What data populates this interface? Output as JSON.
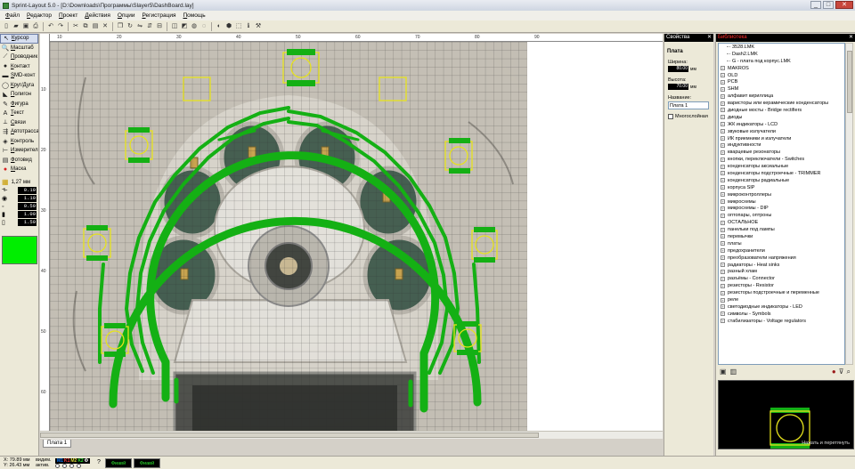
{
  "window": {
    "title": "Sprint-Layout 5.0 - [D:\\Downloads\\Программы\\Slayer5\\DashBoard.lay]",
    "controls": [
      "_",
      "□",
      "✕"
    ]
  },
  "menu": [
    "Файл",
    "Редактор",
    "Проект",
    "Действия",
    "Опции",
    "Регистрация",
    "Помощь"
  ],
  "toolbar": {
    "icons": [
      "new-icon",
      "open-icon",
      "save-icon",
      "print-icon",
      "undo-icon",
      "redo-icon",
      "cut-icon",
      "copy-icon",
      "paste-icon",
      "delete-icon",
      "duplicate-icon",
      "rotate-icon",
      "mirror-h-icon",
      "mirror-v-icon",
      "align-icon",
      "group-icon",
      "ungroup-icon",
      "lock-icon",
      "unlock-icon",
      "zoom-icon",
      "autoroute-icon",
      "drc-icon",
      "info-icon",
      "tool-icon"
    ],
    "glyphs": [
      "▯",
      "▰",
      "▣",
      "⎙",
      "↶",
      "↷",
      "✂",
      "⧉",
      "▤",
      "✕",
      "❐",
      "↻",
      "⇋",
      "⇵",
      "⊟",
      "◫",
      "◩",
      "◍",
      "◌",
      "◐",
      "⬢",
      "⬚",
      "ℹ",
      "⚒"
    ]
  },
  "tools": [
    {
      "label": "Курсор",
      "icon": "cursor-icon",
      "glyph": "↖",
      "active": true
    },
    {
      "label": "Масштаб",
      "icon": "zoom-icon",
      "glyph": "🔍",
      "active": false
    },
    {
      "label": "Проводник",
      "icon": "track-icon",
      "glyph": "⟋",
      "active": false
    },
    {
      "label": "Контакт",
      "icon": "pad-icon",
      "glyph": "●",
      "active": false
    },
    {
      "label": "SMD-конт",
      "icon": "smd-pad-icon",
      "glyph": "▬",
      "active": false
    },
    {
      "label": "Круг/Дуга",
      "icon": "circle-arc-icon",
      "glyph": "◯",
      "active": false
    },
    {
      "label": "Полигон",
      "icon": "polygon-icon",
      "glyph": "◣",
      "active": false
    },
    {
      "label": "Фигура",
      "icon": "shape-icon",
      "glyph": "✎",
      "active": false
    },
    {
      "label": "Текст",
      "icon": "text-icon",
      "glyph": "A",
      "active": false
    },
    {
      "label": "Связи",
      "icon": "connections-icon",
      "glyph": "⟂",
      "active": false
    },
    {
      "label": "Автотрасса",
      "icon": "autoroute-icon",
      "glyph": "⇶",
      "active": false
    },
    {
      "label": "Контроль",
      "icon": "test-icon",
      "glyph": "◈",
      "active": false
    },
    {
      "label": "Измеритель",
      "icon": "measure-icon",
      "glyph": "⊢",
      "active": false
    },
    {
      "label": "Фотовид",
      "icon": "photoview-icon",
      "glyph": "▤",
      "active": false
    },
    {
      "label": "Маска",
      "icon": "mask-icon",
      "glyph": "●",
      "active": false
    }
  ],
  "grid": {
    "value": "1,27 мм"
  },
  "params": [
    {
      "name": "track-width",
      "icon": "track-width-icon",
      "glyph": "⟛",
      "value": "0.10"
    },
    {
      "name": "pad-outer",
      "icon": "pad-size-icon",
      "glyph": "◉",
      "value": "1.10"
    },
    {
      "name": "pad-inner",
      "icon": "pad-hole-icon",
      "glyph": "◦",
      "value": "0.50"
    },
    {
      "name": "smd-width",
      "icon": "smd-width-icon",
      "glyph": "▮",
      "value": "1.00"
    },
    {
      "name": "smd-height",
      "icon": "smd-height-icon",
      "glyph": "▯",
      "value": "1.50"
    }
  ],
  "current_color": "#00ee00",
  "ruler": {
    "top_labels": [
      "10",
      "20",
      "30",
      "40",
      "50",
      "60",
      "70",
      "80",
      "90"
    ],
    "left_labels": [
      "10",
      "20",
      "30",
      "40",
      "50",
      "60"
    ]
  },
  "board_tab": "Плата 1",
  "properties": {
    "header": "Свойства",
    "section": "Плата",
    "width_label": "Ширина:",
    "width_value": "80.00",
    "height_label": "Высота:",
    "height_value": "70.00",
    "unit": "мм",
    "name_label": "Название:",
    "name_value": "Плата 1",
    "multilayer_label": "Многослойная"
  },
  "library": {
    "header": "Библиотека",
    "items": [
      {
        "label": "3528.LMK",
        "leaf": true
      },
      {
        "label": "Dash2.LMK",
        "leaf": true
      },
      {
        "label": "G - плата под корпус.LMK",
        "leaf": true
      },
      {
        "label": "MAKROS",
        "leaf": false
      },
      {
        "label": "OLD",
        "leaf": false
      },
      {
        "label": "PCB",
        "leaf": false
      },
      {
        "label": "SHM",
        "leaf": false
      },
      {
        "label": "алфавит кириллица",
        "leaf": false
      },
      {
        "label": "варисторы или керамические конденсаторы",
        "leaf": false
      },
      {
        "label": "диодные мосты - Bridge rectifiers",
        "leaf": false
      },
      {
        "label": "диоды",
        "leaf": false
      },
      {
        "label": "ЖК индикаторы - LCD",
        "leaf": false
      },
      {
        "label": "звуковые излучатели",
        "leaf": false
      },
      {
        "label": "ИК приемники и излучатели",
        "leaf": false
      },
      {
        "label": "индуктивности",
        "leaf": false
      },
      {
        "label": "кварцевые резонаторы",
        "leaf": false
      },
      {
        "label": "кнопки, переключатели - Switches",
        "leaf": false
      },
      {
        "label": "конденсаторы аксиальные",
        "leaf": false
      },
      {
        "label": "конденсаторы подстроечные - TRIMMER",
        "leaf": false
      },
      {
        "label": "конденсаторы радиальные",
        "leaf": false
      },
      {
        "label": "корпуса SIP",
        "leaf": false
      },
      {
        "label": "микроконтроллеры",
        "leaf": false
      },
      {
        "label": "микросхемы",
        "leaf": false
      },
      {
        "label": "микросхемы - DIP",
        "leaf": false
      },
      {
        "label": "оптопары, оптроны",
        "leaf": false
      },
      {
        "label": "ОСТАЛЬНОЕ",
        "leaf": false
      },
      {
        "label": "панельки под лампы",
        "leaf": false
      },
      {
        "label": "перемычки",
        "leaf": false
      },
      {
        "label": "платы",
        "leaf": false
      },
      {
        "label": "предохранители",
        "leaf": false
      },
      {
        "label": "преобразователи напряжения",
        "leaf": false
      },
      {
        "label": "радиаторы - Heat sinks",
        "leaf": false
      },
      {
        "label": "разный хлам",
        "leaf": false
      },
      {
        "label": "разъёмы - Connector",
        "leaf": false
      },
      {
        "label": "резисторы - Resistor",
        "leaf": false
      },
      {
        "label": "резисторы подстроечные и переменные",
        "leaf": false
      },
      {
        "label": "реле",
        "leaf": false
      },
      {
        "label": "светодиодные индикаторы - LED",
        "leaf": false
      },
      {
        "label": "символы - Symbols",
        "leaf": false
      },
      {
        "label": "стабилизаторы - Voltage regulators",
        "leaf": false
      }
    ],
    "preview_hint": "Нажать и перетянуть"
  },
  "status": {
    "x_label": "X:",
    "x_value": "79.89 мм",
    "y_label": "Y:",
    "y_value": "26.43 мм",
    "visible_label": "видим.",
    "active_label": "актив.",
    "layers": [
      {
        "name": "M1",
        "color": "#0b7cff"
      },
      {
        "name": "K1",
        "color": "#ff3b3b"
      },
      {
        "name": "M2",
        "color": "#d9d93a"
      },
      {
        "name": "K2",
        "color": "#32e632"
      },
      {
        "name": "Ф",
        "color": "#ffffff"
      }
    ],
    "help_label": "?",
    "button1": "Фиавй",
    "button2": "Фиавй"
  }
}
